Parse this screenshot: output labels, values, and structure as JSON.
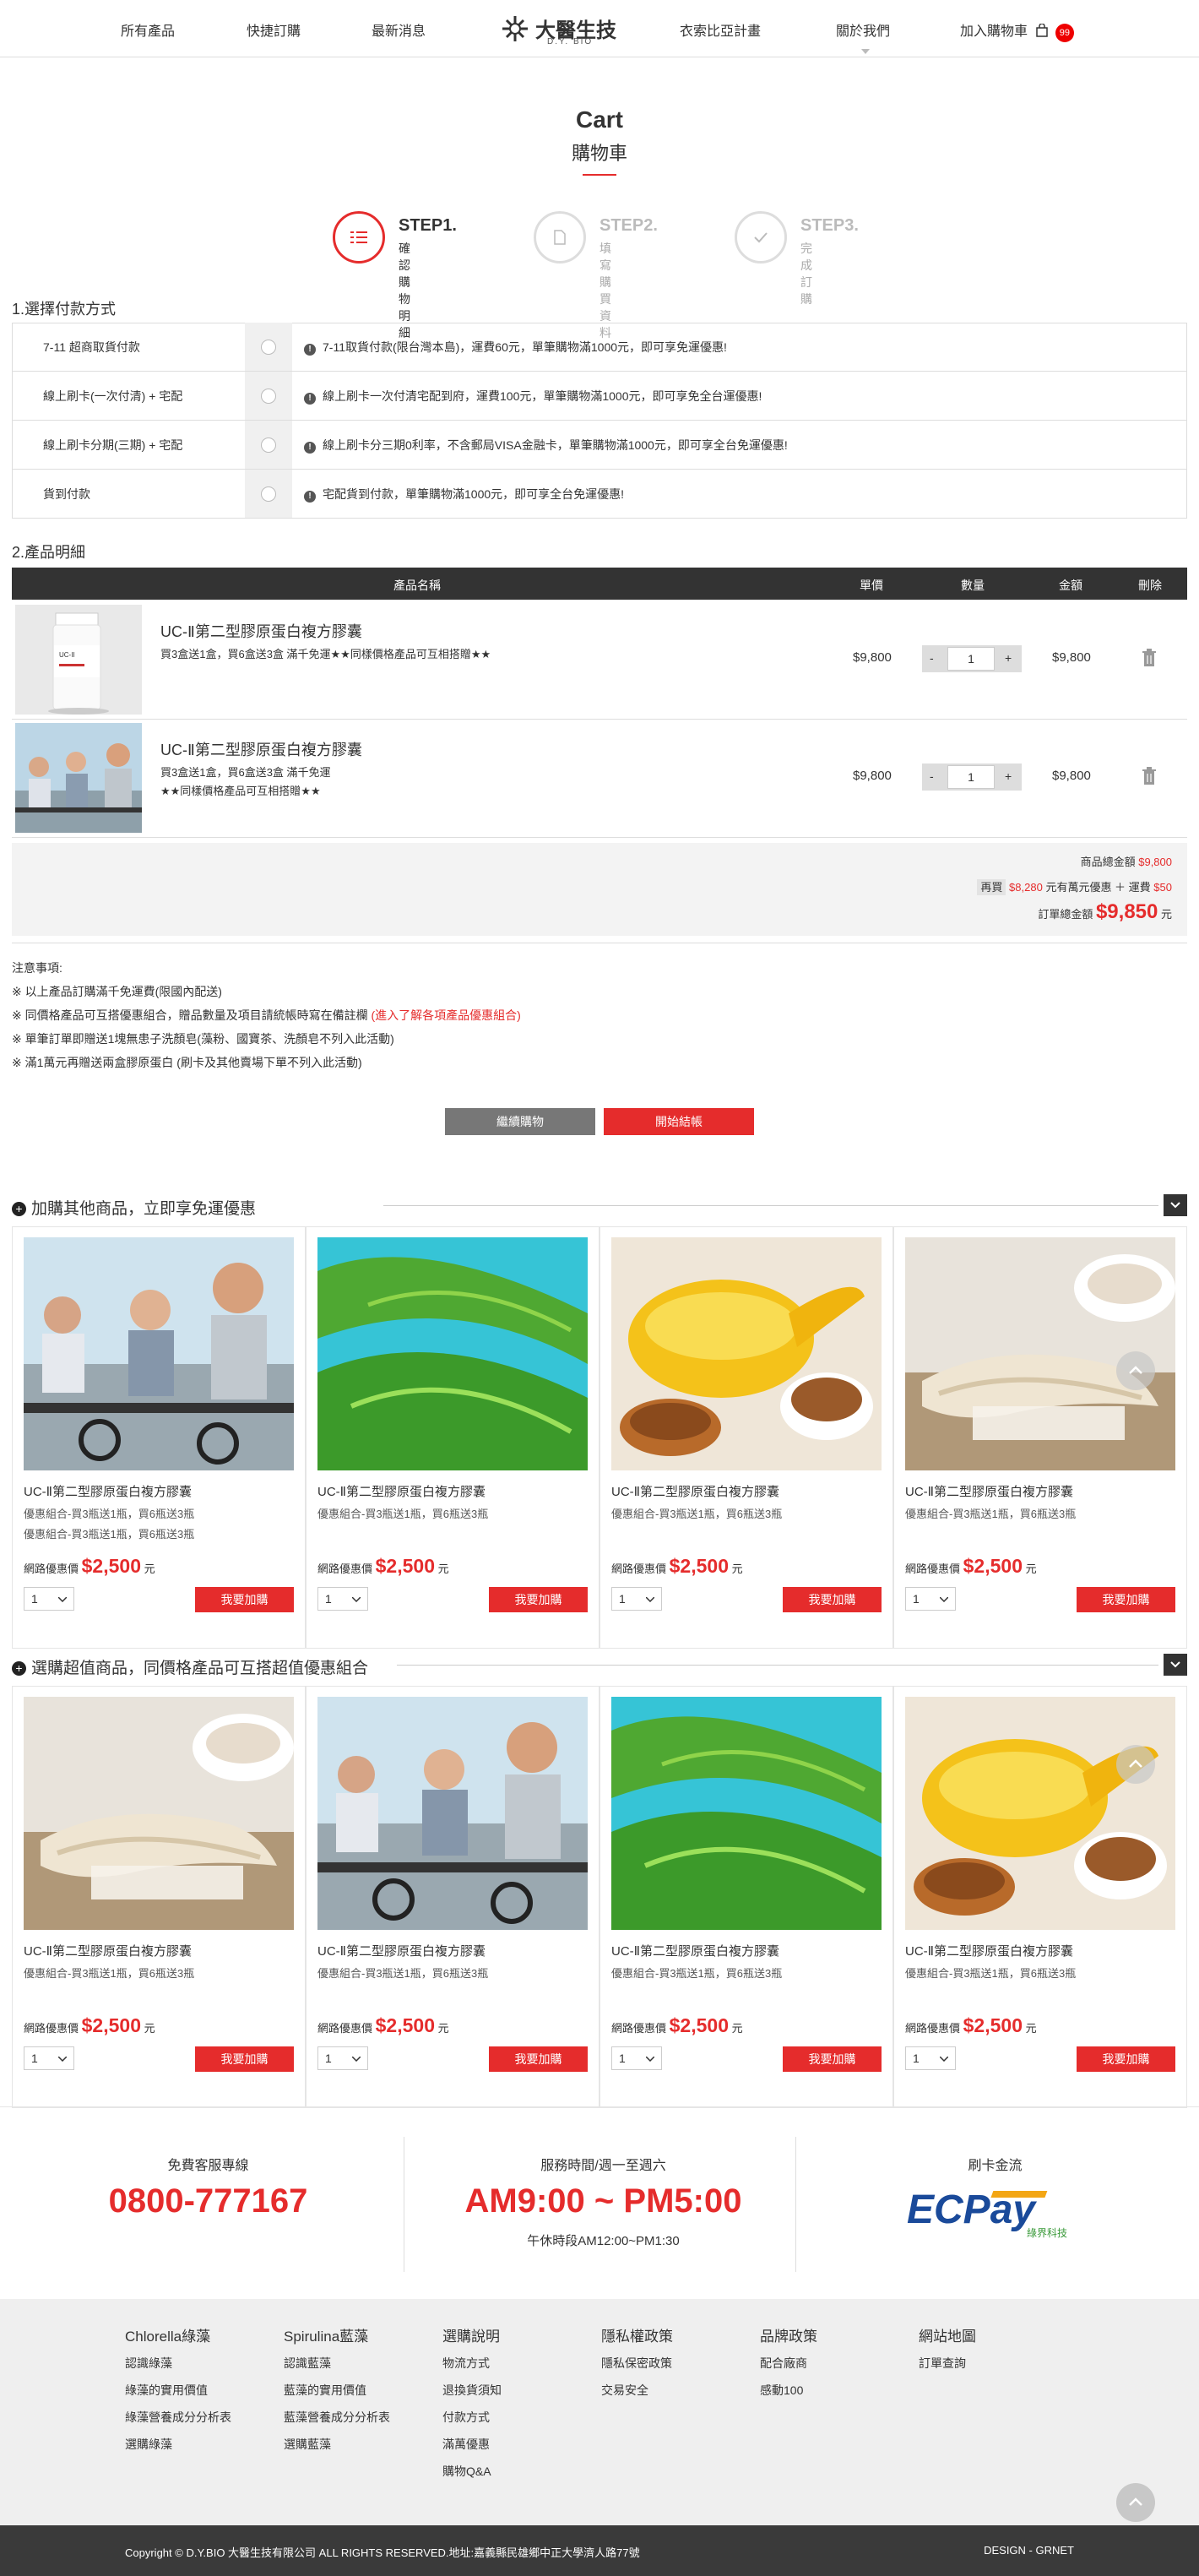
{
  "nav": {
    "items": [
      "所有產品",
      "快捷訂購",
      "最新消息",
      "衣索比亞計畫",
      "關於我們",
      "加入購物車"
    ],
    "logo_text": "大醫生技",
    "logo_sub": "D.Y. BIO",
    "cart_count": "99"
  },
  "page": {
    "title": "Cart",
    "subtitle": "購物車"
  },
  "steps": [
    {
      "label": "STEP1.",
      "sub": "確認購物明細"
    },
    {
      "label": "STEP2.",
      "sub": "填寫購買資料"
    },
    {
      "label": "STEP3.",
      "sub": "完成訂購"
    }
  ],
  "payment": {
    "title": "1.選擇付款方式",
    "rows": [
      {
        "label": "7-11 超商取貨付款",
        "info": "7-11取貨付款(限台灣本島)，運費60元，單筆購物滿1000元，即可享免運優惠!"
      },
      {
        "label": "線上刷卡(一次付清) + 宅配",
        "info": "線上刷卡一次付清宅配到府，運費100元，單筆購物滿1000元，即可享免全台運優惠!"
      },
      {
        "label": "線上刷卡分期(三期) + 宅配",
        "info": "線上刷卡分三期0利率，不含郵局VISA金融卡，單筆購物滿1000元，即可享全台免運優惠!"
      },
      {
        "label": "貨到付款",
        "info": "宅配貨到付款，單筆購物滿1000元，即可享全台免運優惠!"
      }
    ]
  },
  "items_section": {
    "title": "2.產品明細",
    "headers": {
      "name": "產品名稱",
      "price": "單價",
      "qty": "數量",
      "amount": "金額",
      "delete": "刪除"
    },
    "items": [
      {
        "name": "UC-Ⅱ第二型膠原蛋白複方膠囊",
        "desc1": "買3盒送1盒，買6盒送3盒 滿千免運★★同樣價格產品可互相搭贈★★",
        "desc2": "",
        "price": "$9,800",
        "qty": "1",
        "amount": "$9,800"
      },
      {
        "name": "UC-Ⅱ第二型膠原蛋白複方膠囊",
        "desc1": "買3盒送1盒，買6盒送3盒 滿千免運",
        "desc2": "★★同樣價格產品可互相搭贈★★",
        "price": "$9,800",
        "qty": "1",
        "amount": "$9,800"
      }
    ],
    "minus": "-",
    "plus": "+"
  },
  "totals": {
    "subtotal_label": "商品總金額",
    "subtotal": "$9,800",
    "more_prefix": "再買",
    "more_amount": "$8,280",
    "more_suffix": "元有萬元優惠 ＋ 運費",
    "shipping": "$50",
    "grand_label": "訂單總金額",
    "grand": "$9,850",
    "grand_unit": "元"
  },
  "notes": [
    "注意事項:",
    "※ 以上產品訂購滿千免運費(限國內配送)",
    "※ 同價格產品可互搭優惠組合，贈品數量及項目請統帳時寫在備註欄",
    "(進入了解各項產品優惠組合)",
    "※ 單筆訂單即贈送1塊無患子洗顏皂(藻粉、國寶茶、洗顏皂不列入此活動)",
    "※ 滿1萬元再贈送兩盒膠原蛋白 (刷卡及其他賣場下單不列入此活動)"
  ],
  "buttons": {
    "continue": "繼續購物",
    "checkout": "開始結帳"
  },
  "promo1": {
    "title": "加購其他商品，立即享免運優惠",
    "cards": [
      {
        "name": "UC-Ⅱ第二型膠原蛋白複方膠囊",
        "desc": "優惠組合-買3瓶送1瓶，買6瓶送3瓶",
        "desc2": "優惠組合-買3瓶送1瓶，買6瓶送3瓶",
        "price_label": "網路優惠價",
        "price": "$2,500",
        "unit": "元",
        "qty": "1",
        "add": "我要加購",
        "img": "cyclists"
      },
      {
        "name": "UC-Ⅱ第二型膠原蛋白複方膠囊",
        "desc": "優惠組合-買3瓶送1瓶，買6瓶送3瓶",
        "desc2": "",
        "price_label": "網路優惠價",
        "price": "$2,500",
        "unit": "元",
        "qty": "1",
        "add": "我要加購",
        "img": "algae"
      },
      {
        "name": "UC-Ⅱ第二型膠原蛋白複方膠囊",
        "desc": "優惠組合-買3瓶送1瓶，買6瓶送3瓶",
        "desc2": "",
        "price_label": "網路優惠價",
        "price": "$2,500",
        "unit": "元",
        "qty": "1",
        "add": "我要加購",
        "img": "oil"
      },
      {
        "name": "UC-Ⅱ第二型膠原蛋白複方膠囊",
        "desc": "優惠組合-買3瓶送1瓶，買6瓶送3瓶",
        "desc2": "",
        "price_label": "網路優惠價",
        "price": "$2,500",
        "unit": "元",
        "qty": "1",
        "add": "我要加購",
        "img": "ginseng"
      }
    ]
  },
  "promo2": {
    "title": "選購超值商品，同價格產品可互搭超值優惠組合",
    "cards": [
      {
        "name": "UC-Ⅱ第二型膠原蛋白複方膠囊",
        "desc": "優惠組合-買3瓶送1瓶，買6瓶送3瓶",
        "desc2": "",
        "price_label": "網路優惠價",
        "price": "$2,500",
        "unit": "元",
        "qty": "1",
        "add": "我要加購",
        "img": "ginseng"
      },
      {
        "name": "UC-Ⅱ第二型膠原蛋白複方膠囊",
        "desc": "優惠組合-買3瓶送1瓶，買6瓶送3瓶",
        "desc2": "",
        "price_label": "網路優惠價",
        "price": "$2,500",
        "unit": "元",
        "qty": "1",
        "add": "我要加購",
        "img": "cyclists"
      },
      {
        "name": "UC-Ⅱ第二型膠原蛋白複方膠囊",
        "desc": "優惠組合-買3瓶送1瓶，買6瓶送3瓶",
        "desc2": "",
        "price_label": "網路優惠價",
        "price": "$2,500",
        "unit": "元",
        "qty": "1",
        "add": "我要加購",
        "img": "algae"
      },
      {
        "name": "UC-Ⅱ第二型膠原蛋白複方膠囊",
        "desc": "優惠組合-買3瓶送1瓶，買6瓶送3瓶",
        "desc2": "",
        "price_label": "網路優惠價",
        "price": "$2,500",
        "unit": "元",
        "qty": "1",
        "add": "我要加購",
        "img": "oil"
      }
    ]
  },
  "contact": {
    "hotline_label": "免費客服專線",
    "hotline": "0800-777167",
    "hours_label": "服務時間/週一至週六",
    "hours": "AM9:00 ~ PM5:00",
    "lunch": "午休時段AM12:00~PM1:30",
    "pay_label": "刷卡金流",
    "ecpay": "ECPay",
    "ecpay_sub": "綠界科技"
  },
  "footer_links": [
    {
      "head": "Chlorella綠藻",
      "items": [
        "認識綠藻",
        "綠藻的實用價值",
        "綠藻營養成分分析表",
        "選購綠藻"
      ]
    },
    {
      "head": "Spirulina藍藻",
      "items": [
        "認識藍藻",
        "藍藻的實用價值",
        "藍藻營養成分分析表",
        "選購藍藻"
      ]
    },
    {
      "head": "選購說明",
      "items": [
        "物流方式",
        "退換貨須知",
        "付款方式",
        "滿萬優惠",
        "購物Q&A"
      ]
    },
    {
      "head": "隱私權政策",
      "items": [
        "隱私保密政策",
        "交易安全"
      ]
    },
    {
      "head": "品牌政策",
      "items": [
        "配合廠商",
        "感動100"
      ]
    },
    {
      "head": "網站地圖",
      "items": [
        "訂單查詢"
      ]
    }
  ],
  "copyright": "Copyright © D.Y.BIO 大醫生技有限公司 ALL RIGHTS RESERVED.地址:嘉義縣民雄鄉中正大學濟人路77號",
  "design": "DESIGN - GRNET",
  "colors": {
    "accent": "#e52c2c",
    "dark": "#333333"
  }
}
